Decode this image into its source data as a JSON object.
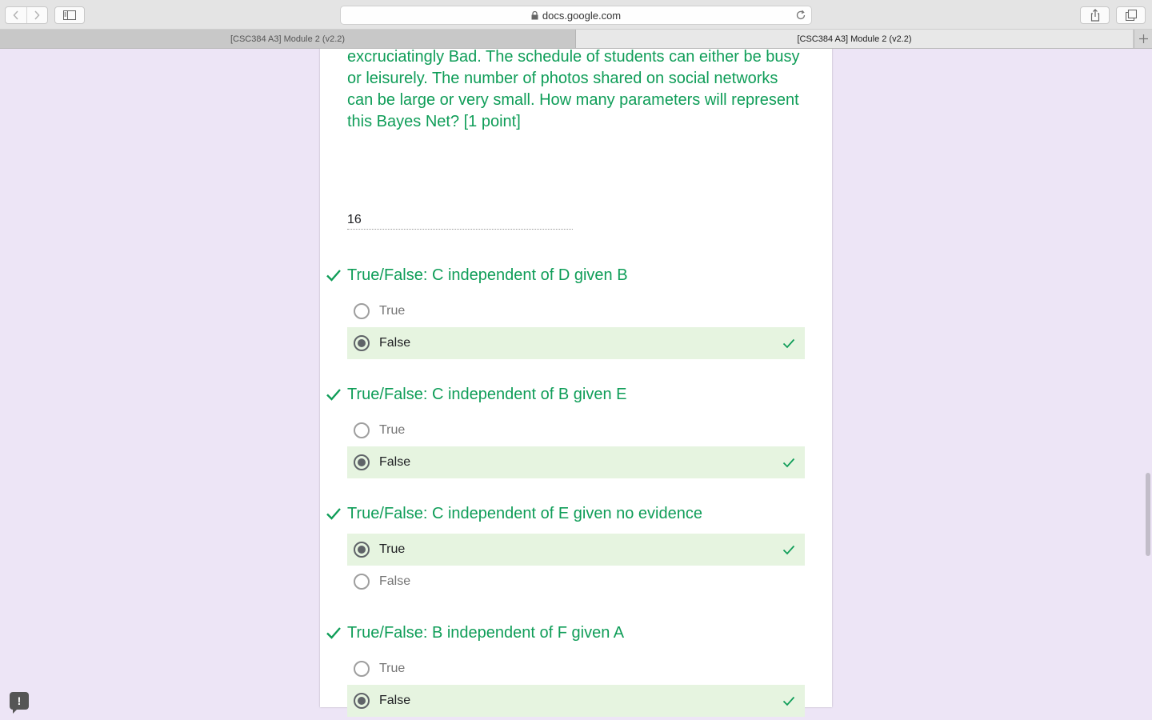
{
  "browser": {
    "url": "docs.google.com",
    "tabs": [
      {
        "title": "[CSC384 A3] Module 2 (v2.2)",
        "active": false
      },
      {
        "title": "[CSC384 A3] Module 2 (v2.2)",
        "active": true
      }
    ]
  },
  "colors": {
    "accent_green": "#0f9d58",
    "correct_bg": "#e6f4e0",
    "page_bg": "#ede5f6"
  },
  "form": {
    "previous_question_text": "excruciatingly Bad. The schedule of students can either be busy or leisurely. The number of photos shared on social networks can be large or very small. How many parameters will represent this Bayes Net? [1 point]",
    "previous_answer": "16",
    "questions": [
      {
        "title": "True/False:   C independent of D given B",
        "options": [
          {
            "label": "True",
            "selected": false,
            "correct": false
          },
          {
            "label": "False",
            "selected": true,
            "correct": true
          }
        ]
      },
      {
        "title": "True/False:   C independent of B given E",
        "options": [
          {
            "label": "True",
            "selected": false,
            "correct": false
          },
          {
            "label": "False",
            "selected": true,
            "correct": true
          }
        ]
      },
      {
        "title": "True/False:   C independent of E given no evidence",
        "options": [
          {
            "label": "True",
            "selected": true,
            "correct": true
          },
          {
            "label": "False",
            "selected": false,
            "correct": false
          }
        ]
      },
      {
        "title": "True/False: B independent of F given A",
        "options": [
          {
            "label": "True",
            "selected": false,
            "correct": false
          },
          {
            "label": "False",
            "selected": true,
            "correct": true
          }
        ]
      }
    ]
  },
  "feedback_label": "!"
}
